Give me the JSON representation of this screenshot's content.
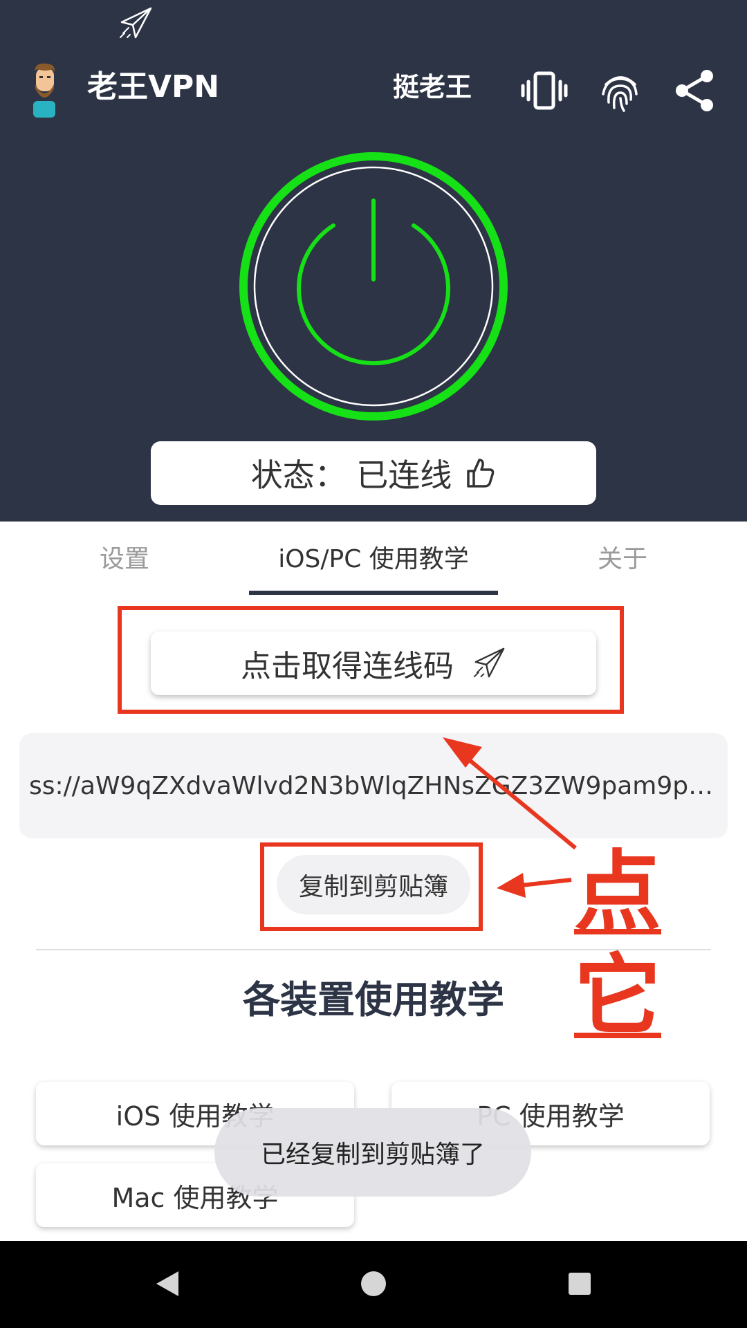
{
  "app": {
    "title": "老王VPN",
    "support_label": "挺老王",
    "icons": [
      "paper-plane-icon",
      "avatar-icon",
      "vibrate-icon",
      "fingerprint-icon",
      "share-icon"
    ]
  },
  "status": {
    "text": "状态：  已连线",
    "icon": "thumbs-up-icon"
  },
  "power": {
    "state": "connected",
    "color": "#16e016"
  },
  "tabs": [
    {
      "label": "设置",
      "selected": false
    },
    {
      "label": "iOS/PC 使用教学",
      "selected": true
    },
    {
      "label": "关于",
      "selected": false
    }
  ],
  "connection": {
    "get_code_label": "点击取得连线码",
    "code_value": "ss://aW9qZXdvaWlvd2N3bWlqZHNsZGZ3ZW9pam9pd2...",
    "copy_label": "复制到剪贴簿"
  },
  "annotation": {
    "text": "点它",
    "color": "#e8361f"
  },
  "tutorials": {
    "title": "各装置使用教学",
    "ios_label": "iOS 使用教学",
    "pc_label": "PC 使用教学",
    "mac_label": "Mac 使用教学"
  },
  "toast": {
    "text": "已经复制到剪贴簿了"
  },
  "colors": {
    "primary": "#2d3446",
    "accent": "#16e016",
    "annotation": "#e8361f"
  }
}
